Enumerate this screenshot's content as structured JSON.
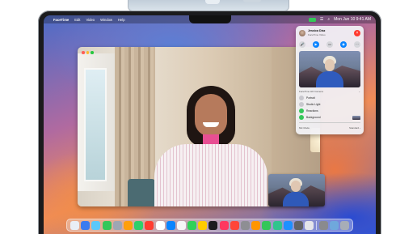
{
  "menubar": {
    "apple_glyph": "",
    "app_name": "FaceTime",
    "items": [
      "Edit",
      "Video",
      "Window",
      "Help"
    ],
    "clock": "Mon Jun 10 9:41 AM"
  },
  "call_panel": {
    "caller_name": "Jessica Diaz",
    "caller_subtitle": "FaceTime Video",
    "end_label": "×",
    "controls": [
      {
        "name": "mic",
        "glyph": "🎤"
      },
      {
        "name": "camera",
        "glyph": "▶"
      },
      {
        "name": "screen-share",
        "glyph": "▭"
      },
      {
        "name": "audio",
        "glyph": "◉"
      },
      {
        "name": "more",
        "glyph": "⋯"
      }
    ],
    "effects_section_title": "FaceTime HD Camera",
    "effects_chevron": "⌄",
    "effects": [
      {
        "label": "Portrait",
        "on": false
      },
      {
        "label": "Studio Light",
        "on": false
      },
      {
        "label": "Reactions",
        "on": true
      },
      {
        "label": "Background",
        "on": true
      }
    ],
    "footer_left": "Mic Mode",
    "footer_right": "Standard ›"
  },
  "dock_colors": [
    "#e9eef5",
    "#3a7bf0",
    "#5ac8fa",
    "#34c759",
    "#9ea6b4",
    "#ff9f0a",
    "#2ecf6a",
    "#ff3b30",
    "#ffffff",
    "#0a84ff",
    "#f5f5f7",
    "#30d158",
    "#ffcc00",
    "#1c1c1e",
    "#ff375f",
    "#ff453a",
    "#8e8e93",
    "#ff9500",
    "#34c759",
    "#30c48d",
    "#1e90ff",
    "#636366",
    "#e5e5ea",
    "#8a8a8e",
    "#6fa8dc",
    "#a7adb7"
  ]
}
